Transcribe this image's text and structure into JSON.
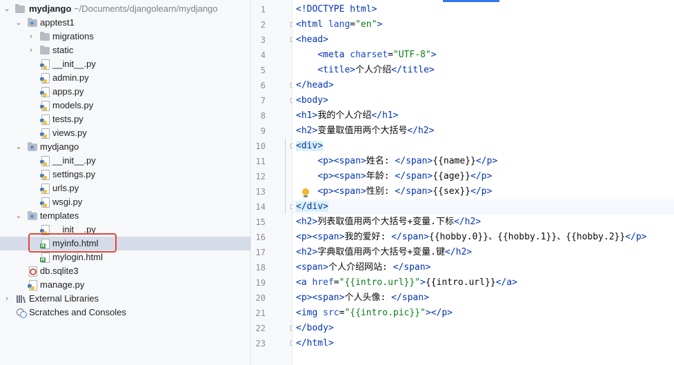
{
  "project": {
    "root": {
      "name": "mydjango",
      "path": "~/Documents/djangolearn/mydjango"
    },
    "items": [
      {
        "label": "apptest1",
        "kind": "folder",
        "expanded": true
      },
      {
        "label": "migrations",
        "kind": "folder",
        "expanded": false
      },
      {
        "label": "static",
        "kind": "folder",
        "expanded": false
      },
      {
        "label": "__init__.py",
        "kind": "py"
      },
      {
        "label": "admin.py",
        "kind": "py"
      },
      {
        "label": "apps.py",
        "kind": "py"
      },
      {
        "label": "models.py",
        "kind": "py"
      },
      {
        "label": "tests.py",
        "kind": "py"
      },
      {
        "label": "views.py",
        "kind": "py"
      },
      {
        "label": "mydjango",
        "kind": "folder",
        "expanded": true
      },
      {
        "label": "__init__.py",
        "kind": "py"
      },
      {
        "label": "settings.py",
        "kind": "py"
      },
      {
        "label": "urls.py",
        "kind": "py"
      },
      {
        "label": "wsgi.py",
        "kind": "py"
      },
      {
        "label": "templates",
        "kind": "folder",
        "expanded": true
      },
      {
        "label": "__init__.py",
        "kind": "py"
      },
      {
        "label": "myinfo.html",
        "kind": "html",
        "selected": true
      },
      {
        "label": "mylogin.html",
        "kind": "html"
      },
      {
        "label": "db.sqlite3",
        "kind": "db"
      },
      {
        "label": "manage.py",
        "kind": "py"
      }
    ],
    "external_libraries": "External Libraries",
    "scratches": "Scratches and Consoles"
  },
  "editor": {
    "line_numbers": [
      "1",
      "2",
      "3",
      "4",
      "5",
      "6",
      "7",
      "8",
      "9",
      "10",
      "11",
      "12",
      "13",
      "14",
      "15",
      "16",
      "17",
      "18",
      "19",
      "20",
      "21",
      "22",
      "23"
    ],
    "lines": [
      "<!DOCTYPE html>",
      "<html lang=\"en\">",
      "<head>",
      "    <meta charset=\"UTF-8\">",
      "    <title>个人介绍</title>",
      "</head>",
      "<body>",
      "<h1>我的个人介绍</h1>",
      "<h2>变量取值用两个大括号</h2>",
      "<div>",
      "    <p><span>姓名: </span>{{name}}</p>",
      "    <p><span>年龄: </span>{{age}}</p>",
      "    <p><span>性别: </span>{{sex}}</p>",
      "</div>",
      "<h2>列表取值用两个大括号+变量.下标</h2>",
      "<p><span>我的爱好: </span>{{hobby.0}}、{{hobby.1}}、{{hobby.2}}</p>",
      "<h2>字典取值用两个大括号+变量.键</h2>",
      "<span>个人介绍网站: </span>",
      "<a href=\"{{intro.url}}\">{{intro.url}}</a>",
      "<p><span>个人头像: </span>",
      "<img src=\"{{intro.pic}}\"></p>",
      "</body>",
      "</html>"
    ],
    "current_line": 14,
    "accent_color": "#3574f0",
    "tag_color": "#0033b3",
    "string_color": "#067d17"
  }
}
